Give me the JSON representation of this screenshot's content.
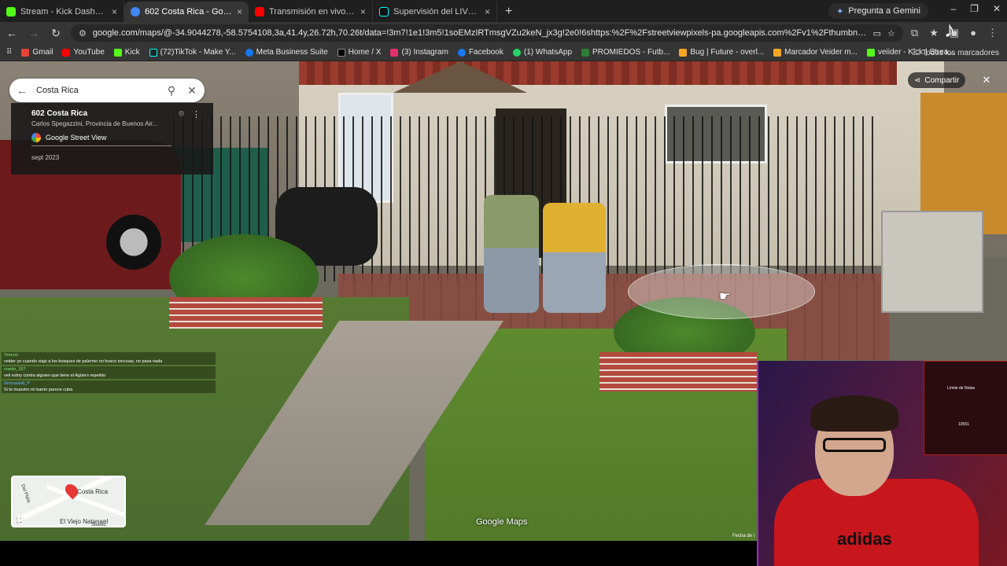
{
  "browser": {
    "tabs": [
      {
        "label": "Stream - Kick Dashboard",
        "color": "#53fc18"
      },
      {
        "label": "602 Costa Rica - Google Maps",
        "color": "#4285f4"
      },
      {
        "label": "Transmisión en vivo - YouTube",
        "color": "#ff0000"
      },
      {
        "label": "Supervisión del LIVE | Centro LIVE",
        "color": "#111111"
      }
    ],
    "gemini_label": "Pregunta a Gemini",
    "url": "google.com/maps/@-34.9044278,-58.5754108,3a,41.4y,26.72h,70.26t/data=!3m7!1e1!3m5!1soEMzIRTmsgVZu2keN_jx3g!2e0!6shttps:%2F%2Fstreetviewpixels-pa.googleapis.com%2Fv1%2Fthumbnail%3Fcb_client%3Dmaps_sv.tacti..."
  },
  "bookmarks": [
    {
      "label": "Gmail",
      "color": "#ea4335"
    },
    {
      "label": "YouTube",
      "color": "#ff0000"
    },
    {
      "label": "Kick",
      "color": "#53fc18"
    },
    {
      "label": "(72)TikTok - Make Y...",
      "color": "#111111"
    },
    {
      "label": "Meta Business Suite",
      "color": "#1877f2"
    },
    {
      "label": "Home / X",
      "color": "#000000"
    },
    {
      "label": "(3) Instagram",
      "color": "#e1306c"
    },
    {
      "label": "Facebook",
      "color": "#1877f2"
    },
    {
      "label": "(1) WhatsApp",
      "color": "#25d366"
    },
    {
      "label": "PROMIEDOS - Futb...",
      "color": "#2e7d32"
    },
    {
      "label": "Bug | Future - overl...",
      "color": "#f5a623"
    },
    {
      "label": "Marcador Veider m...",
      "color": "#f5a623"
    },
    {
      "label": "veiider - Kick | Strea...",
      "color": "#53fc18"
    }
  ],
  "bookmarks_all": "Todos los marcadores",
  "maps": {
    "search_value": "Costa Rica",
    "place_title": "602 Costa Rica",
    "place_address": "Carlos Spegazzini, Provincia de Buenos Air...",
    "source": "Google Street View",
    "date": "sept 2023",
    "share_label": "Compartir",
    "watermark": "Google Maps",
    "date_label": "Fecha de i",
    "minimap": {
      "place": "Costa Rica",
      "poi": "El Viejo Natanael",
      "street1": "Del Plata",
      "street2": "Suarez"
    }
  },
  "chat": [
    {
      "user": "Temuni",
      "message": "veider yo cuando viajo a los bosques de palermo no busco excusas, no pasa nada"
    },
    {
      "user": "martin_157",
      "message": "veii estoy contra alguien que tiene el Agüero repetido"
    },
    {
      "user": "Gimnasia8_P",
      "message": "Si te muestro mi barrio parece cuba"
    }
  ],
  "cam": {
    "shirt_text": "adidas",
    "overlay_title": "Límite de Notas",
    "overlay_count": "10551"
  }
}
